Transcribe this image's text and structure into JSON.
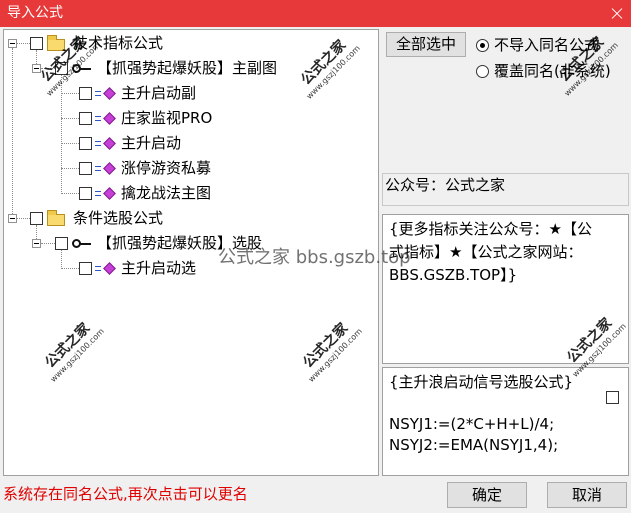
{
  "window": {
    "title": "导入公式"
  },
  "tree": {
    "folders": [
      {
        "label": "技术指标公式",
        "checked": false,
        "expanded": true,
        "groups": [
          {
            "label": "【抓强势起爆妖股】主副图",
            "checked": false,
            "expanded": true,
            "formulas": [
              {
                "label": "主升启动副",
                "checked": false
              },
              {
                "label": "庄家监视PRO",
                "checked": false
              },
              {
                "label": "主升启动",
                "checked": false
              },
              {
                "label": "涨停游资私募",
                "checked": false
              },
              {
                "label": "擒龙战法主图",
                "checked": false
              }
            ]
          }
        ]
      },
      {
        "label": "条件选股公式",
        "checked": false,
        "expanded": true,
        "groups": [
          {
            "label": "【抓强势起爆妖股】选股",
            "checked": false,
            "expanded": true,
            "formulas": [
              {
                "label": "主升启动选",
                "checked": false
              }
            ]
          }
        ]
      }
    ]
  },
  "options": {
    "select_all_label": "全部选中",
    "duplicate_handling": [
      {
        "label": "不导入同名公式",
        "selected": true
      },
      {
        "label": "覆盖同名(非系统)",
        "selected": false
      }
    ]
  },
  "wechat_label": "公众号：公式之家",
  "description": "{更多指标关注公众号：★【公式指标】★【公式之家网站：BBS.GSZB.TOP】}",
  "formula_preview": {
    "header_comment": "{主升浪启动信号选股公式}",
    "code_lines": [
      "NSYJ1:=(2*C+H+L)/4;",
      "NSYJ2:=EMA(NSYJ1,4);"
    ],
    "checked": false
  },
  "status_message": "系统存在同名公式,再次点击可以更名",
  "buttons": {
    "ok": "确定",
    "cancel": "取消"
  },
  "watermark": {
    "brand": "公式之家",
    "url": "www.gszj100.com",
    "banner": "公式之家 bbs.gszb.top"
  },
  "icons": {
    "close": "close-icon",
    "collapse": "collapse-icon",
    "checkbox": "checkbox-icon",
    "folder": "folder-icon",
    "formula_group": "key-icon",
    "formula": "formula-diamond-icon",
    "radio": "radio-icon"
  },
  "colors": {
    "title_bar": "#e8393a",
    "title_text": "#ffffff",
    "status_text": "#e00000",
    "folder": "#f9da6e",
    "formula_icon": "#c63fd6"
  }
}
